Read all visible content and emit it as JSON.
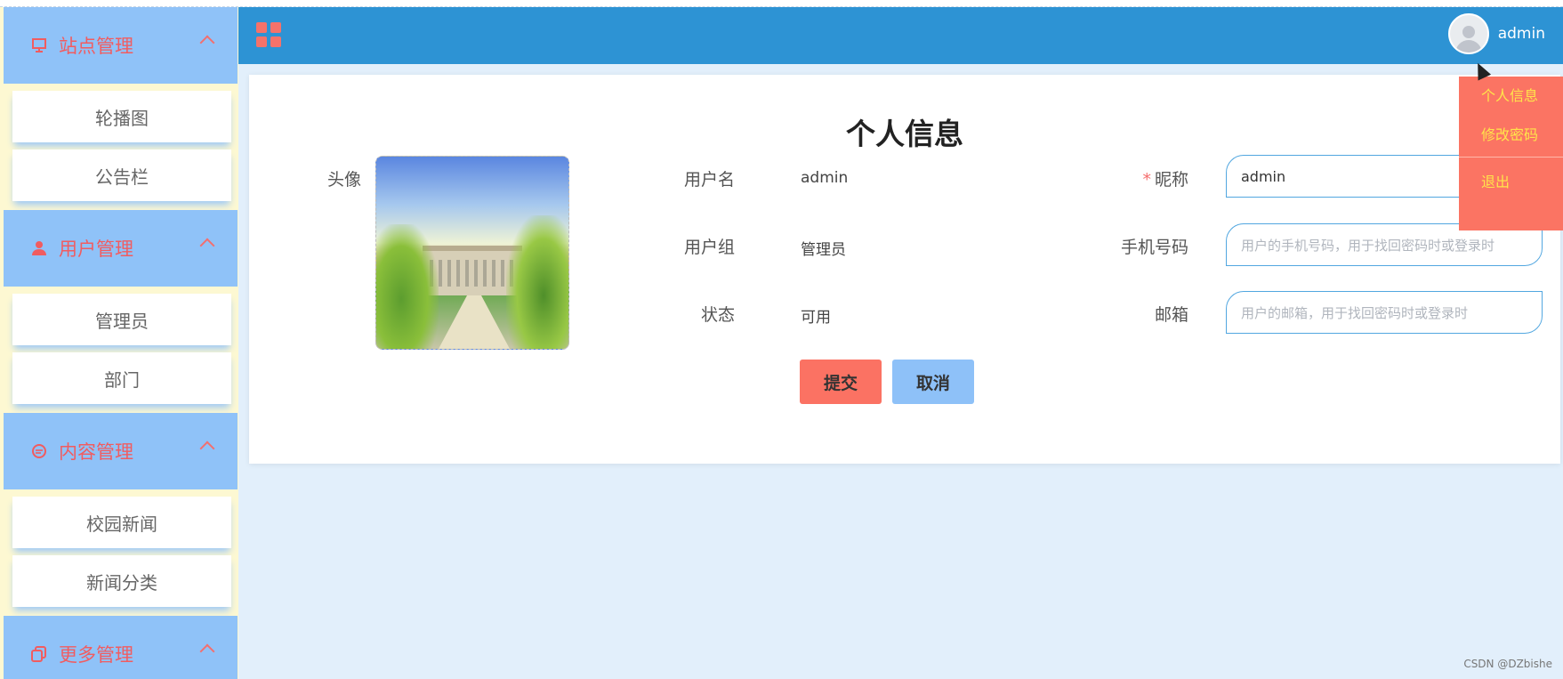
{
  "sidebar": {
    "groups": [
      {
        "label": "站点管理",
        "items": [
          "轮播图",
          "公告栏"
        ]
      },
      {
        "label": "用户管理",
        "items": [
          "管理员",
          "部门"
        ]
      },
      {
        "label": "内容管理",
        "items": [
          "校园新闻",
          "新闻分类"
        ]
      },
      {
        "label": "更多管理",
        "items": []
      }
    ]
  },
  "header": {
    "username": "admin"
  },
  "dropdown": {
    "items": [
      "个人信息",
      "修改密码",
      "退出"
    ]
  },
  "form": {
    "title": "个人信息",
    "avatar_label": "头像",
    "username_label": "用户名",
    "username_value": "admin",
    "group_label": "用户组",
    "group_value": "管理员",
    "status_label": "状态",
    "status_value": "可用",
    "nickname_required": "*",
    "nickname_label": "昵称",
    "nickname_value": "admin",
    "phone_label": "手机号码",
    "phone_placeholder": "用户的手机号码，用于找回密码时或登录时",
    "email_label": "邮箱",
    "email_placeholder": "用户的邮箱，用于找回密码时或登录时",
    "submit": "提交",
    "cancel": "取消"
  },
  "watermark": "CSDN @DZbishe",
  "colors": {
    "header": "#2d93d4",
    "sidebar_group": "#8fc2f8",
    "accent_red": "#fb7263",
    "page_bg": "#e2effb"
  }
}
